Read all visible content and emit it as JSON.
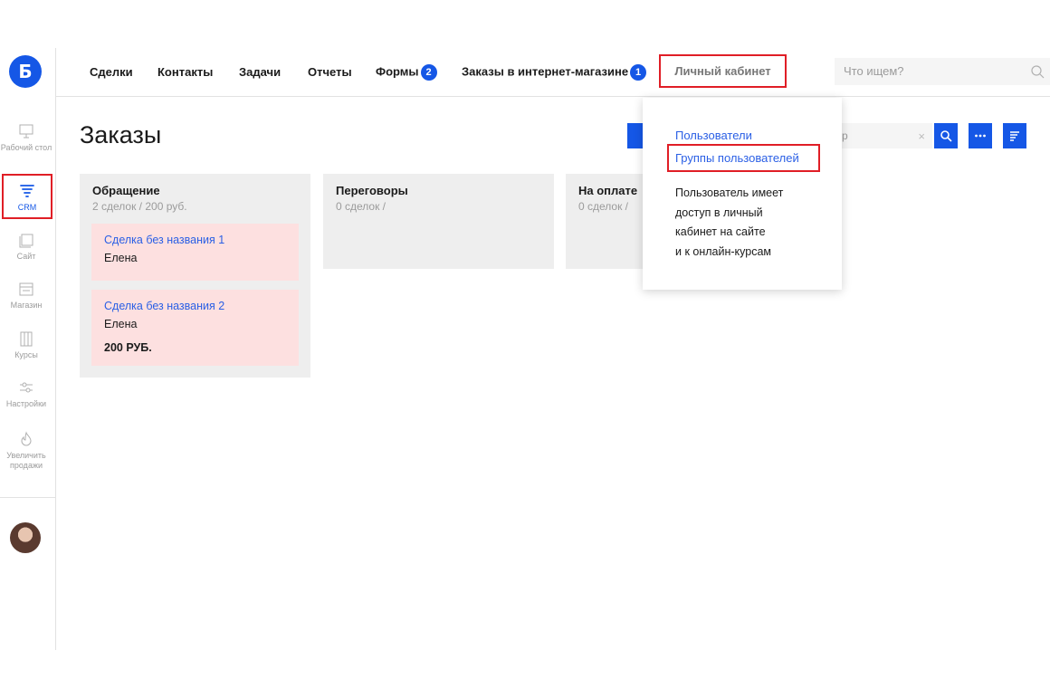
{
  "brand": {
    "logo_letter": "Б",
    "accent_color": "#1557e6",
    "highlight_color": "#e01e26"
  },
  "sidebar": {
    "items": [
      {
        "label": "Рабочий стол",
        "icon": "desktop-icon"
      },
      {
        "label": "CRM",
        "icon": "funnel-icon",
        "active": true
      },
      {
        "label": "Сайт",
        "icon": "site-icon"
      },
      {
        "label": "Магазин",
        "icon": "shop-icon"
      },
      {
        "label": "Курсы",
        "icon": "courses-icon"
      },
      {
        "label": "Настройки",
        "icon": "settings-sliders-icon"
      },
      {
        "label": "Увеличить продажи",
        "icon": "flame-icon"
      }
    ]
  },
  "topnav": {
    "items": [
      {
        "label": "Сделки"
      },
      {
        "label": "Контакты"
      },
      {
        "label": "Задачи"
      },
      {
        "label": "Отчеты"
      },
      {
        "label": "Формы",
        "badge": "2"
      },
      {
        "label": "Заказы в интернет-магазине",
        "badge": "1"
      }
    ],
    "active_item": "Личный кабинет",
    "search_placeholder": "Что ищем?"
  },
  "main": {
    "title": "Заказы",
    "filter_partial_text": "р",
    "filter_clear": "×",
    "columns": [
      {
        "title": "Обращение",
        "subtitle": "2 сделок / 200 руб.",
        "cards": [
          {
            "title": "Сделка без названия 1",
            "contact": "Елена"
          },
          {
            "title": "Сделка без названия 2",
            "contact": "Елена",
            "price": "200 РУБ."
          }
        ]
      },
      {
        "title": "Переговоры",
        "subtitle": "0 сделок /"
      },
      {
        "title": "На оплате",
        "subtitle": "0 сделок /"
      }
    ]
  },
  "dropdown": {
    "items": [
      {
        "label": "Пользователи"
      },
      {
        "label": "Группы пользователей",
        "highlighted": true
      }
    ],
    "description_lines": [
      "Пользователь имеет",
      "доступ в личный",
      "кабинет на сайте",
      "и к онлайн-курсам"
    ]
  }
}
